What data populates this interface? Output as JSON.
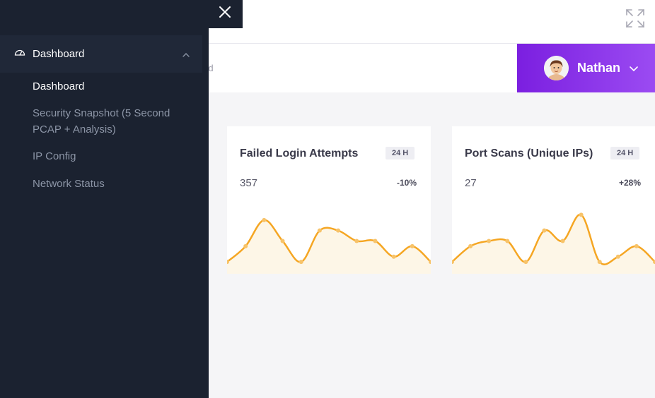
{
  "breadcrumb": {
    "tail": "rd"
  },
  "user": {
    "name": "Nathan"
  },
  "sidebar": {
    "section_label": "Dashboard",
    "items": [
      {
        "label": "Dashboard",
        "active": true
      },
      {
        "label": "Security Snapshot (5 Second PCAP + Analysis)",
        "active": false
      },
      {
        "label": "IP Config",
        "active": false
      },
      {
        "label": "Network Status",
        "active": false
      }
    ]
  },
  "cards": [
    {
      "title": "Failed Login Attempts",
      "badge": "24 H",
      "value": "357",
      "change": "-10%"
    },
    {
      "title": "Port Scans (Unique IPs)",
      "badge": "24 H",
      "value": "27",
      "change": "+28%"
    }
  ],
  "colors": {
    "accent": "#7b1fe0",
    "sidebar": "#1b2230",
    "spark_line": "#f5a623",
    "spark_fill": "#fdf6e7"
  },
  "chart_data": [
    {
      "type": "area",
      "series": [
        {
          "values": [
            2,
            5,
            10,
            6,
            2,
            8,
            8,
            6,
            6,
            3,
            5,
            2
          ]
        }
      ]
    },
    {
      "type": "area",
      "series": [
        {
          "values": [
            2,
            5,
            6,
            6,
            2,
            8,
            6,
            11,
            2,
            3,
            5,
            2
          ]
        }
      ]
    }
  ]
}
